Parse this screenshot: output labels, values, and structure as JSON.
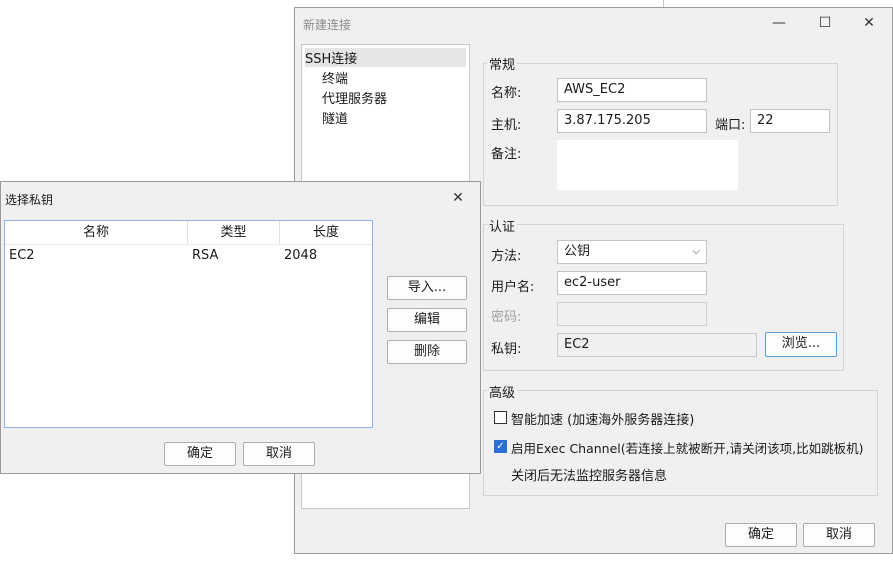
{
  "new_connection": {
    "title": "新建连接",
    "tree": [
      "SSH连接",
      "终端",
      "代理服务器",
      "隧道"
    ],
    "general": {
      "legend": "常规",
      "name_label": "名称:",
      "name_value": "AWS_EC2",
      "host_label": "主机:",
      "host_value": "3.87.175.205",
      "port_label": "端口:",
      "port_value": "22",
      "note_label": "备注:",
      "note_value": ""
    },
    "auth": {
      "legend": "认证",
      "method_label": "方法:",
      "method_value": "公钥",
      "user_label": "用户名:",
      "user_value": "ec2-user",
      "password_label": "密码:",
      "password_value": "",
      "key_label": "私钥:",
      "key_value": "EC2",
      "browse_label": "浏览..."
    },
    "advanced": {
      "legend": "高级",
      "smart_accel_label": "智能加速 (加速海外服务器连接)",
      "smart_accel_checked": false,
      "exec_channel_label": "启用Exec Channel(若连接上就被断开,请关闭该项,比如跳板机)",
      "exec_channel_checked": true,
      "exec_channel_note": "关闭后无法监控服务器信息"
    },
    "ok_label": "确定",
    "cancel_label": "取消",
    "controls": {
      "minimize": "—",
      "maximize": "☐",
      "close": "✕"
    }
  },
  "select_key": {
    "title": "选择私钥",
    "close": "✕",
    "columns": [
      "名称",
      "类型",
      "长度"
    ],
    "rows": [
      {
        "name": "EC2",
        "type": "RSA",
        "length": "2048"
      }
    ],
    "import_label": "导入...",
    "edit_label": "编辑",
    "delete_label": "删除",
    "ok_label": "确定",
    "cancel_label": "取消"
  },
  "colors": {
    "accent": "#2b6fd6",
    "list_border": "#8ab4e8",
    "dialog_bg": "#f0f0f0"
  },
  "icons": {
    "checkbox": "check-icon",
    "dropdown": "chevron-down-icon"
  }
}
